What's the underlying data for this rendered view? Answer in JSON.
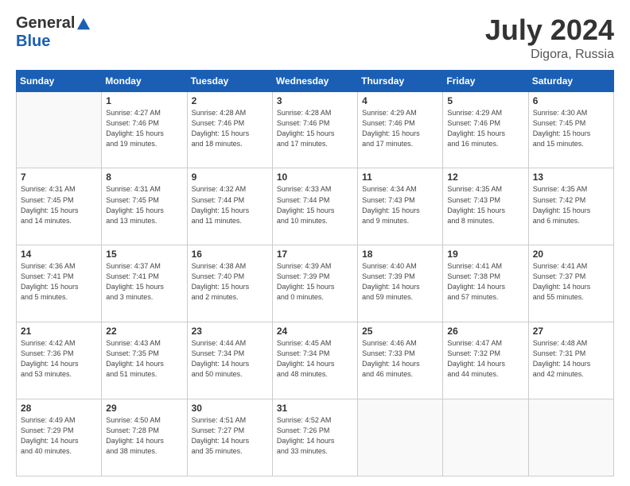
{
  "header": {
    "logo_general": "General",
    "logo_blue": "Blue",
    "title": "July 2024",
    "location": "Digora, Russia"
  },
  "days_of_week": [
    "Sunday",
    "Monday",
    "Tuesday",
    "Wednesday",
    "Thursday",
    "Friday",
    "Saturday"
  ],
  "weeks": [
    [
      {
        "day": "",
        "info": ""
      },
      {
        "day": "1",
        "info": "Sunrise: 4:27 AM\nSunset: 7:46 PM\nDaylight: 15 hours\nand 19 minutes."
      },
      {
        "day": "2",
        "info": "Sunrise: 4:28 AM\nSunset: 7:46 PM\nDaylight: 15 hours\nand 18 minutes."
      },
      {
        "day": "3",
        "info": "Sunrise: 4:28 AM\nSunset: 7:46 PM\nDaylight: 15 hours\nand 17 minutes."
      },
      {
        "day": "4",
        "info": "Sunrise: 4:29 AM\nSunset: 7:46 PM\nDaylight: 15 hours\nand 17 minutes."
      },
      {
        "day": "5",
        "info": "Sunrise: 4:29 AM\nSunset: 7:46 PM\nDaylight: 15 hours\nand 16 minutes."
      },
      {
        "day": "6",
        "info": "Sunrise: 4:30 AM\nSunset: 7:45 PM\nDaylight: 15 hours\nand 15 minutes."
      }
    ],
    [
      {
        "day": "7",
        "info": "Sunrise: 4:31 AM\nSunset: 7:45 PM\nDaylight: 15 hours\nand 14 minutes."
      },
      {
        "day": "8",
        "info": "Sunrise: 4:31 AM\nSunset: 7:45 PM\nDaylight: 15 hours\nand 13 minutes."
      },
      {
        "day": "9",
        "info": "Sunrise: 4:32 AM\nSunset: 7:44 PM\nDaylight: 15 hours\nand 11 minutes."
      },
      {
        "day": "10",
        "info": "Sunrise: 4:33 AM\nSunset: 7:44 PM\nDaylight: 15 hours\nand 10 minutes."
      },
      {
        "day": "11",
        "info": "Sunrise: 4:34 AM\nSunset: 7:43 PM\nDaylight: 15 hours\nand 9 minutes."
      },
      {
        "day": "12",
        "info": "Sunrise: 4:35 AM\nSunset: 7:43 PM\nDaylight: 15 hours\nand 8 minutes."
      },
      {
        "day": "13",
        "info": "Sunrise: 4:35 AM\nSunset: 7:42 PM\nDaylight: 15 hours\nand 6 minutes."
      }
    ],
    [
      {
        "day": "14",
        "info": "Sunrise: 4:36 AM\nSunset: 7:41 PM\nDaylight: 15 hours\nand 5 minutes."
      },
      {
        "day": "15",
        "info": "Sunrise: 4:37 AM\nSunset: 7:41 PM\nDaylight: 15 hours\nand 3 minutes."
      },
      {
        "day": "16",
        "info": "Sunrise: 4:38 AM\nSunset: 7:40 PM\nDaylight: 15 hours\nand 2 minutes."
      },
      {
        "day": "17",
        "info": "Sunrise: 4:39 AM\nSunset: 7:39 PM\nDaylight: 15 hours\nand 0 minutes."
      },
      {
        "day": "18",
        "info": "Sunrise: 4:40 AM\nSunset: 7:39 PM\nDaylight: 14 hours\nand 59 minutes."
      },
      {
        "day": "19",
        "info": "Sunrise: 4:41 AM\nSunset: 7:38 PM\nDaylight: 14 hours\nand 57 minutes."
      },
      {
        "day": "20",
        "info": "Sunrise: 4:41 AM\nSunset: 7:37 PM\nDaylight: 14 hours\nand 55 minutes."
      }
    ],
    [
      {
        "day": "21",
        "info": "Sunrise: 4:42 AM\nSunset: 7:36 PM\nDaylight: 14 hours\nand 53 minutes."
      },
      {
        "day": "22",
        "info": "Sunrise: 4:43 AM\nSunset: 7:35 PM\nDaylight: 14 hours\nand 51 minutes."
      },
      {
        "day": "23",
        "info": "Sunrise: 4:44 AM\nSunset: 7:34 PM\nDaylight: 14 hours\nand 50 minutes."
      },
      {
        "day": "24",
        "info": "Sunrise: 4:45 AM\nSunset: 7:34 PM\nDaylight: 14 hours\nand 48 minutes."
      },
      {
        "day": "25",
        "info": "Sunrise: 4:46 AM\nSunset: 7:33 PM\nDaylight: 14 hours\nand 46 minutes."
      },
      {
        "day": "26",
        "info": "Sunrise: 4:47 AM\nSunset: 7:32 PM\nDaylight: 14 hours\nand 44 minutes."
      },
      {
        "day": "27",
        "info": "Sunrise: 4:48 AM\nSunset: 7:31 PM\nDaylight: 14 hours\nand 42 minutes."
      }
    ],
    [
      {
        "day": "28",
        "info": "Sunrise: 4:49 AM\nSunset: 7:29 PM\nDaylight: 14 hours\nand 40 minutes."
      },
      {
        "day": "29",
        "info": "Sunrise: 4:50 AM\nSunset: 7:28 PM\nDaylight: 14 hours\nand 38 minutes."
      },
      {
        "day": "30",
        "info": "Sunrise: 4:51 AM\nSunset: 7:27 PM\nDaylight: 14 hours\nand 35 minutes."
      },
      {
        "day": "31",
        "info": "Sunrise: 4:52 AM\nSunset: 7:26 PM\nDaylight: 14 hours\nand 33 minutes."
      },
      {
        "day": "",
        "info": ""
      },
      {
        "day": "",
        "info": ""
      },
      {
        "day": "",
        "info": ""
      }
    ]
  ]
}
